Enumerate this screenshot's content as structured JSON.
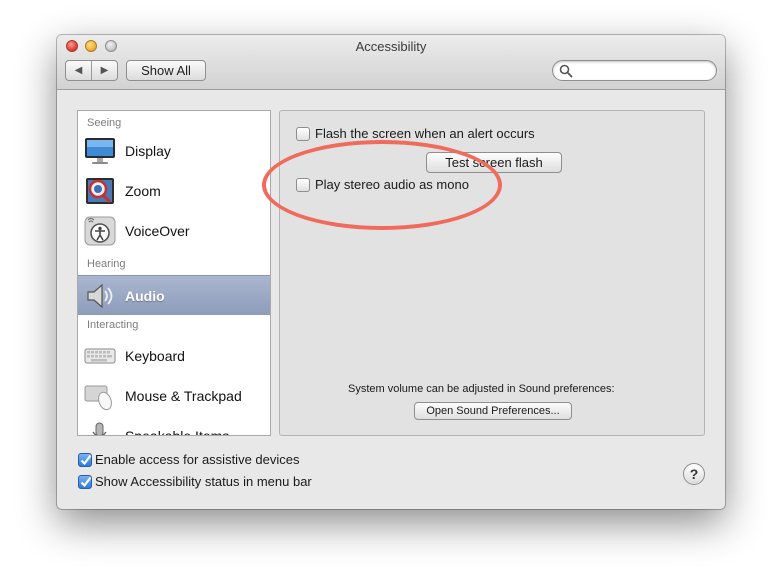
{
  "window": {
    "title": "Accessibility"
  },
  "toolbar": {
    "back_label": "◀",
    "forward_label": "▶",
    "show_all_label": "Show All",
    "search_value": "",
    "search_placeholder": ""
  },
  "sidebar": {
    "sections": [
      {
        "heading": "Seeing"
      },
      {
        "heading": "Hearing"
      },
      {
        "heading": "Interacting"
      }
    ],
    "items": [
      {
        "label": "Display",
        "icon": "display-icon"
      },
      {
        "label": "Zoom",
        "icon": "zoom-icon"
      },
      {
        "label": "VoiceOver",
        "icon": "voiceover-icon"
      },
      {
        "label": "Audio",
        "icon": "speaker-icon",
        "selected": true
      },
      {
        "label": "Keyboard",
        "icon": "keyboard-icon"
      },
      {
        "label": "Mouse & Trackpad",
        "icon": "mouse-icon"
      },
      {
        "label": "Speakable Items",
        "icon": "microphone-icon"
      }
    ]
  },
  "audio_pane": {
    "flash_label": "Flash the screen when an alert occurs",
    "flash_checked": false,
    "test_flash_label": "Test screen flash",
    "mono_label": "Play stereo audio as mono",
    "mono_checked": false,
    "volume_note": "System volume can be adjusted in Sound preferences:",
    "open_sound_label": "Open Sound Preferences..."
  },
  "footer": {
    "assistive_label": "Enable access for assistive devices",
    "assistive_checked": true,
    "status_label": "Show Accessibility status in menu bar",
    "status_checked": true,
    "help_label": "?"
  },
  "colors": {
    "annotation": "#f06b5c",
    "selection": "#8d9cba",
    "checkbox_checked": "#2c7ae0"
  }
}
